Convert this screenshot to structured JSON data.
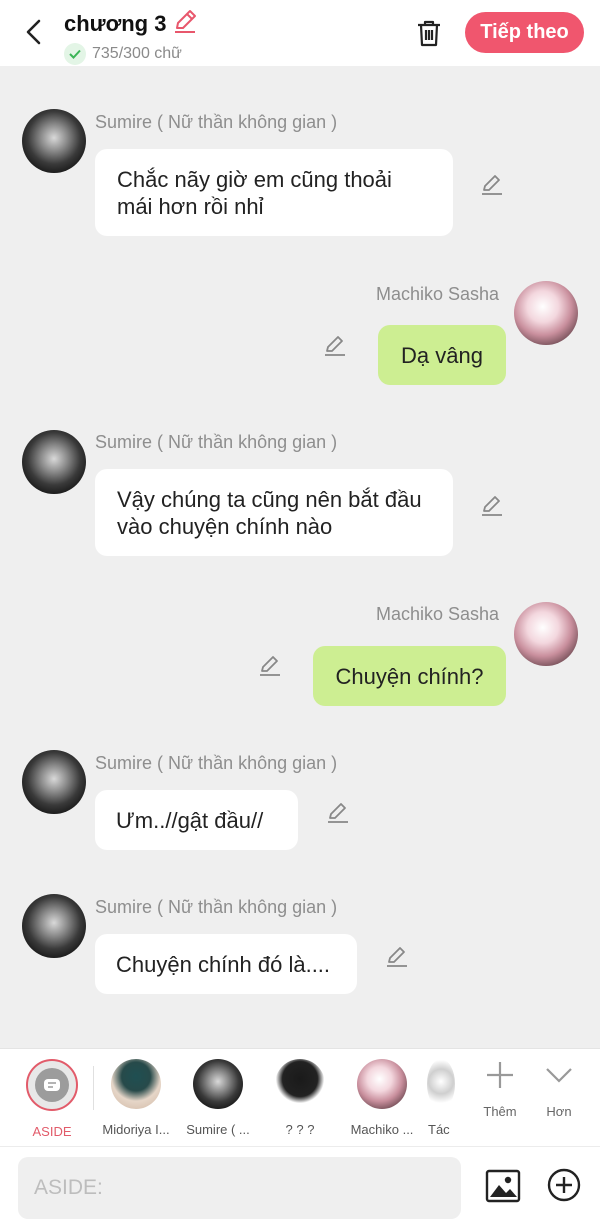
{
  "header": {
    "title": "chương 3",
    "word_count": "735/300 chữ",
    "next_label": "Tiếp theo"
  },
  "messages": [
    {
      "sender": "Sumire ( Nữ thần không gian )",
      "side": "left",
      "text": "Chắc nãy giờ em cũng thoải mái hơn rồi nhỉ"
    },
    {
      "sender": "Machiko Sasha",
      "side": "right",
      "text": "Dạ vâng"
    },
    {
      "sender": "Sumire ( Nữ thần không gian )",
      "side": "left",
      "text": "Vậy chúng ta cũng nên bắt đầu vào chuyện chính nào"
    },
    {
      "sender": "Machiko Sasha",
      "side": "right",
      "text": "Chuyện chính?"
    },
    {
      "sender": "Sumire ( Nữ thần không gian )",
      "side": "left",
      "text": "Ưm..//gật đầu//"
    },
    {
      "sender": "Sumire ( Nữ thần không gian )",
      "side": "left",
      "text": "Chuyện chính đó là...."
    }
  ],
  "characters": [
    {
      "label": "ASIDE",
      "color": "#e25b6a"
    },
    {
      "label": "Midoriya I..."
    },
    {
      "label": "Sumire ( ..."
    },
    {
      "label": "? ? ?"
    },
    {
      "label": "Machiko ..."
    },
    {
      "label": "Tác"
    }
  ],
  "tools": {
    "add_label": "Thêm",
    "more_label": "Hơn"
  },
  "input": {
    "placeholder": "ASIDE:"
  },
  "colors": {
    "accent": "#f0566e",
    "bubble_right": "#cdee92",
    "background": "#efefef"
  }
}
